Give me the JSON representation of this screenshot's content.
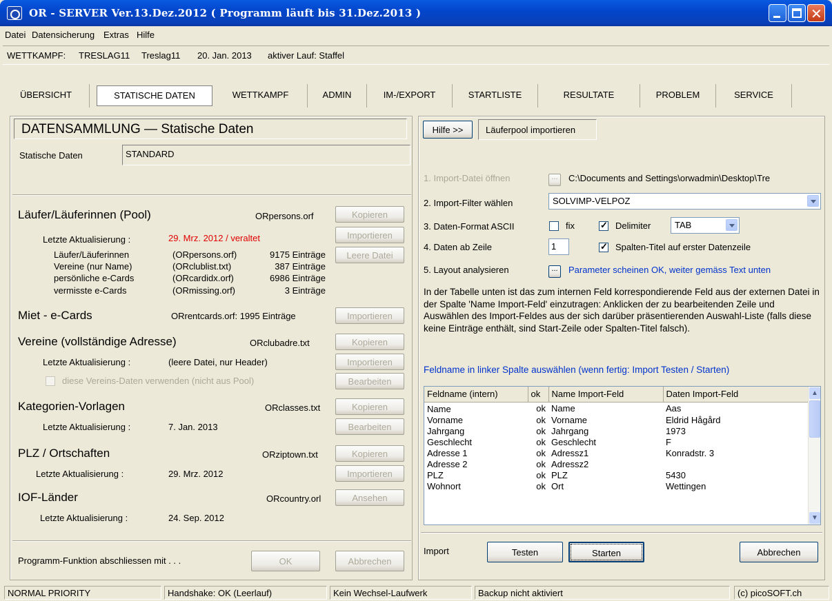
{
  "window": {
    "title": "OR - SERVER    Ver.13.Dez.2012     ( Programm läuft bis 31.Dez.2013 )"
  },
  "menu": {
    "items": [
      "Datei",
      "Datensicherung",
      "Extras",
      "Hilfe"
    ]
  },
  "infobar": {
    "label": "WETTKAMPF:",
    "code": "TRESLAG11",
    "name": "Treslag11",
    "date": "20. Jan. 2013",
    "active_run": "aktiver Lauf: Staffel"
  },
  "tabs": [
    "ÜBERSICHT",
    "STATISCHE DATEN",
    "WETTKAMPF",
    "ADMIN",
    "IM-/EXPORT",
    "STARTLISTE",
    "RESULTATE",
    "PROBLEM",
    "SERVICE"
  ],
  "left": {
    "heading": "DATENSAMMLUNG — Statische Daten",
    "static_label": "Statische Daten",
    "static_value": "STANDARD",
    "pool": {
      "title": "Läufer/Läuferinnen (Pool)",
      "file": "ORpersons.orf",
      "update_label": "Letzte Aktualisierung :",
      "update_value": "29. Mrz. 2012 / veraltet",
      "rows": [
        {
          "name": "Läufer/Läuferinnen",
          "file": "(ORpersons.orf)",
          "count": "9175 Einträge"
        },
        {
          "name": "Vereine (nur Name)",
          "file": "(ORclublist.txt)",
          "count": "387 Einträge"
        },
        {
          "name": "persönliche e-Cards",
          "file": "(ORcardidx.orf)",
          "count": "6986 Einträge"
        },
        {
          "name": "vermisste e-Cards",
          "file": "(ORmissing.orf)",
          "count": "3 Einträge"
        }
      ],
      "btn_copy": "Kopieren",
      "btn_import": "Importieren",
      "btn_empty": "Leere Datei"
    },
    "rent": {
      "title": "Miet - e-Cards",
      "file": "ORrentcards.orf: 1995 Einträge",
      "btn_import": "Importieren"
    },
    "clubs": {
      "title": "Vereine (vollständige Adresse)",
      "file": "ORclubadre.txt",
      "update_label": "Letzte Aktualisierung :",
      "update_value": "(leere Datei, nur Header)",
      "checkbox_label": "diese Vereins-Daten verwenden (nicht aus Pool)",
      "btn_copy": "Kopieren",
      "btn_import": "Importieren",
      "btn_edit": "Bearbeiten"
    },
    "classes": {
      "title": "Kategorien-Vorlagen",
      "file": "ORclasses.txt",
      "update_label": "Letzte Aktualisierung :",
      "update_value": "7. Jan. 2013",
      "btn_copy": "Kopieren",
      "btn_edit": "Bearbeiten"
    },
    "zip": {
      "title": "PLZ / Ortschaften",
      "file": "ORziptown.txt",
      "update_label": "Letzte Aktualisierung :",
      "update_value": "29. Mrz. 2012",
      "btn_copy": "Kopieren",
      "btn_import": "Importieren"
    },
    "iof": {
      "title": "IOF-Länder",
      "file": "ORcountry.orl",
      "update_label": "Letzte Aktualisierung :",
      "update_value": "24. Sep. 2012",
      "btn_view": "Ansehen"
    },
    "footer_label": "Programm-Funktion abschliessen mit . . .",
    "btn_ok": "OK",
    "btn_cancel": "Abbrechen"
  },
  "right": {
    "btn_help": "Hilfe >>",
    "tab_title": "Läuferpool importieren",
    "step1": {
      "label": "1. Import-Datei öffnen",
      "btn": "...",
      "path": "C:\\Documents and Settings\\orwadmin\\Desktop\\Tre"
    },
    "step2": {
      "label": "2. Import-Filter wählen",
      "value": "SOLVIMP-VELPOZ"
    },
    "step3": {
      "label": "3. Daten-Format ASCII",
      "fix_label": "fix",
      "fix_checked": false,
      "delim_label": "Delimiter",
      "delim_checked": true,
      "delim_value": "TAB"
    },
    "step4": {
      "label": "4. Daten ab Zeile",
      "value": "1",
      "header_label": "Spalten-Titel auf erster Datenzeile",
      "header_checked": true
    },
    "step5": {
      "label": "5. Layout analysieren",
      "btn": "...",
      "status": "Parameter scheinen OK, weiter gemäss Text unten"
    },
    "instructions": "In der Tabelle unten ist das zum internen Feld korrespondierende Feld aus der externen Datei in der Spalte 'Name Import-Feld' einzutragen: Anklicken der zu bearbeitenden Zeile und Auswählen des Import-Feldes aus der sich darüber präsentierenden Auswahl-Liste (falls diese keine Einträge enthält, sind Start-Zeile oder Spalten-Titel falsch).",
    "hint": "Feldname in linker Spalte auswählen (wenn fertig: Import Testen / Starten)",
    "table": {
      "columns": [
        "Feldname (intern)",
        "ok",
        "Name Import-Feld",
        "Daten Import-Feld"
      ],
      "rows": [
        [
          "Name",
          "ok",
          "Name",
          "Aas"
        ],
        [
          "Vorname",
          "ok",
          "Vorname",
          "Eldrid Hågård"
        ],
        [
          "Jahrgang",
          "ok",
          "Jahrgang",
          "1973"
        ],
        [
          "Geschlecht",
          "ok",
          "Geschlecht",
          "F"
        ],
        [
          "Adresse 1",
          "ok",
          "Adressz1",
          "Konradstr. 3"
        ],
        [
          "Adresse 2",
          "ok",
          "Adressz2",
          ""
        ],
        [
          "PLZ",
          "ok",
          "PLZ",
          "5430"
        ],
        [
          "Wohnort",
          "ok",
          "Ort",
          "Wettingen"
        ]
      ]
    },
    "import_label": "Import",
    "btn_test": "Testen",
    "btn_start": "Starten",
    "btn_cancel": "Abbrechen"
  },
  "status": {
    "priority": "NORMAL PRIORITY",
    "handshake": "Handshake: OK (Leerlauf)",
    "drive": "Kein Wechsel-Laufwerk",
    "backup": "Backup nicht aktiviert",
    "copyright": "(c) picoSOFT.ch"
  },
  "colors": {
    "warning": "#e00000",
    "info": "#0033cc",
    "titlebar": "#0246cc"
  }
}
